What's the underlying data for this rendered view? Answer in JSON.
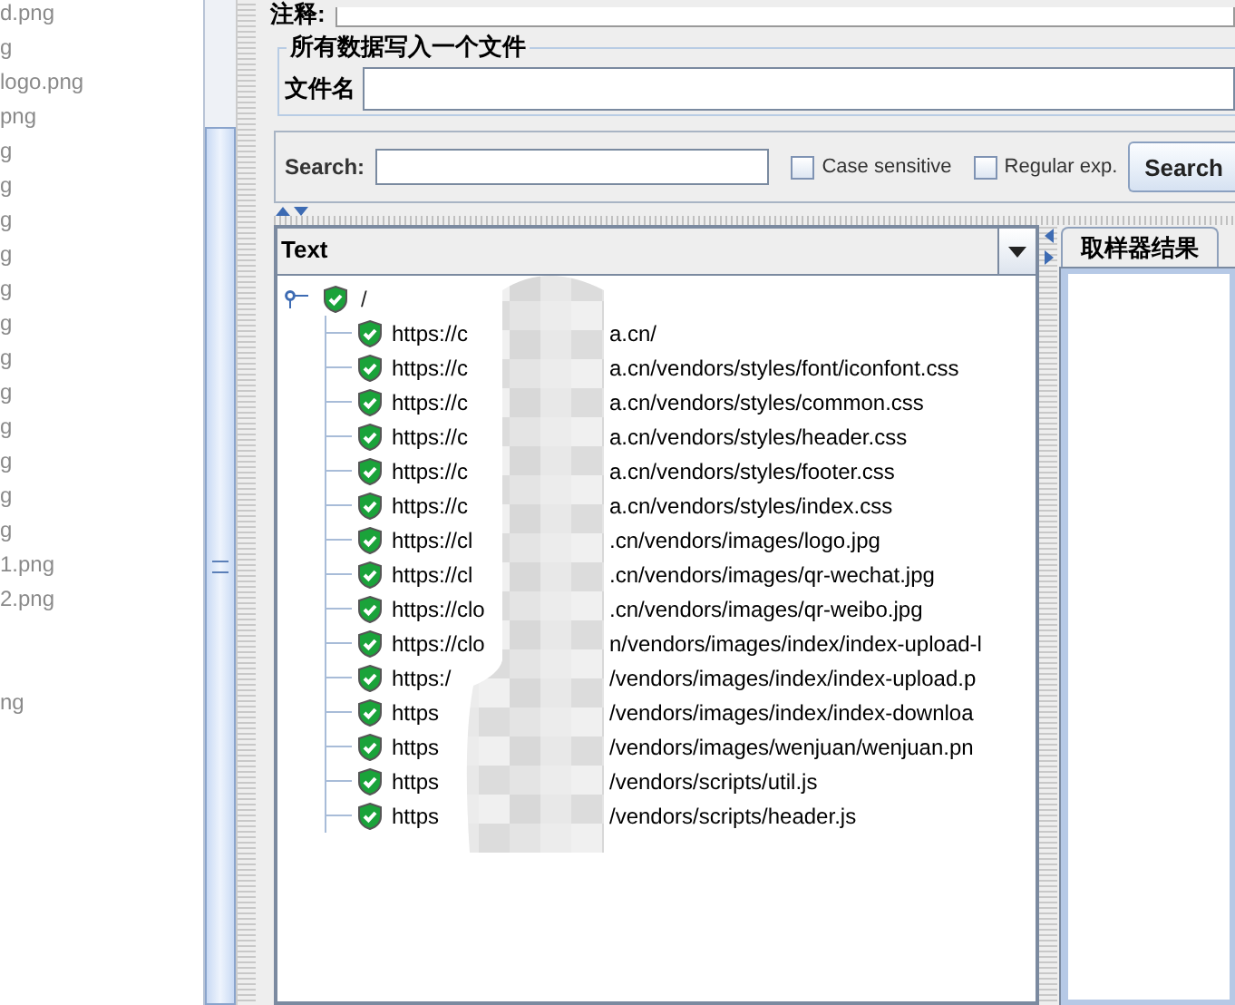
{
  "file_list": {
    "groups": [
      [
        "d.png",
        "g",
        "logo.png",
        "png",
        "g",
        "g",
        "g",
        "g",
        "g",
        "g",
        "g",
        "g",
        "g",
        "g",
        "g",
        "g",
        "1.png",
        "2.png"
      ],
      [
        "ng"
      ]
    ]
  },
  "comment": {
    "label": "注释:"
  },
  "write_all": {
    "title": "所有数据写入一个文件",
    "filename_label": "文件名"
  },
  "search": {
    "label": "Search:",
    "case_sensitive": {
      "label": "Case sensitive",
      "checked": false
    },
    "regex": {
      "label": "Regular exp.",
      "checked": false
    },
    "button": "Search"
  },
  "renderer": {
    "selected": "Text"
  },
  "tree": {
    "label": "/",
    "expanded": true,
    "children": [
      {
        "prefix": "https://c",
        "suffix": "a.cn/"
      },
      {
        "prefix": "https://c",
        "suffix": "a.cn/vendors/styles/font/iconfont.css"
      },
      {
        "prefix": "https://c",
        "suffix": "a.cn/vendors/styles/common.css"
      },
      {
        "prefix": "https://c",
        "suffix": "a.cn/vendors/styles/header.css"
      },
      {
        "prefix": "https://c",
        "suffix": "a.cn/vendors/styles/footer.css"
      },
      {
        "prefix": "https://c",
        "suffix": "a.cn/vendors/styles/index.css"
      },
      {
        "prefix": "https://cl",
        "suffix": ".cn/vendors/images/logo.jpg"
      },
      {
        "prefix": "https://cl",
        "suffix": ".cn/vendors/images/qr-wechat.jpg"
      },
      {
        "prefix": "https://clo",
        "suffix": ".cn/vendors/images/qr-weibo.jpg"
      },
      {
        "prefix": "https://clo",
        "suffix": "n/vendors/images/index/index-upload-l"
      },
      {
        "prefix": "https:/",
        "suffix": "/vendors/images/index/index-upload.p"
      },
      {
        "prefix": "https",
        "suffix": "/vendors/images/index/index-downloa"
      },
      {
        "prefix": "https",
        "suffix": "/vendors/images/wenjuan/wenjuan.pn"
      },
      {
        "prefix": "https",
        "suffix": "/vendors/scripts/util.js"
      },
      {
        "prefix": "https",
        "suffix": "/vendors/scripts/header.js"
      }
    ]
  },
  "result_tabs": [
    {
      "label": "取样器结果",
      "selected": false
    }
  ]
}
